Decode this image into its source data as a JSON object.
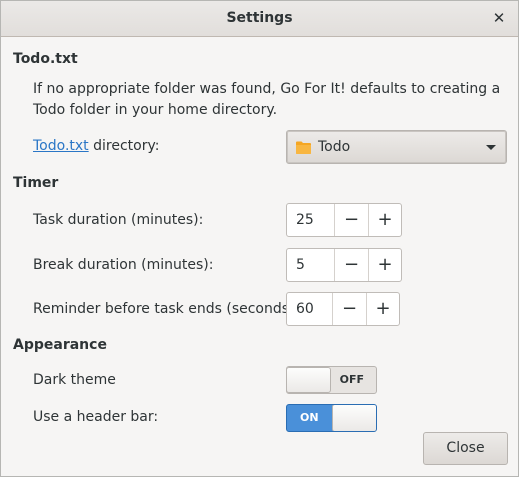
{
  "window": {
    "title": "Settings"
  },
  "todo": {
    "section_title": "Todo.txt",
    "description": "If no appropriate folder was found, Go For It! defaults to creating a Todo folder in your home directory.",
    "directory_link": "Todo.txt",
    "directory_suffix": " directory:",
    "folder_value": "Todo"
  },
  "timer": {
    "section_title": "Timer",
    "task_duration_label": "Task duration (minutes):",
    "task_duration_value": "25",
    "break_duration_label": "Break duration (minutes):",
    "break_duration_value": "5",
    "reminder_label": "Reminder before task ends (seconds):",
    "reminder_value": "60",
    "minus_symbol": "−",
    "plus_symbol": "+"
  },
  "appearance": {
    "section_title": "Appearance",
    "dark_theme_label": "Dark theme",
    "dark_theme_state": "OFF",
    "header_bar_label": "Use a header bar:",
    "header_bar_state": "ON"
  },
  "footer": {
    "close_label": "Close"
  },
  "colors": {
    "accent": "#4a90d9",
    "link": "#2a76c6",
    "folder": "#f5a623"
  }
}
